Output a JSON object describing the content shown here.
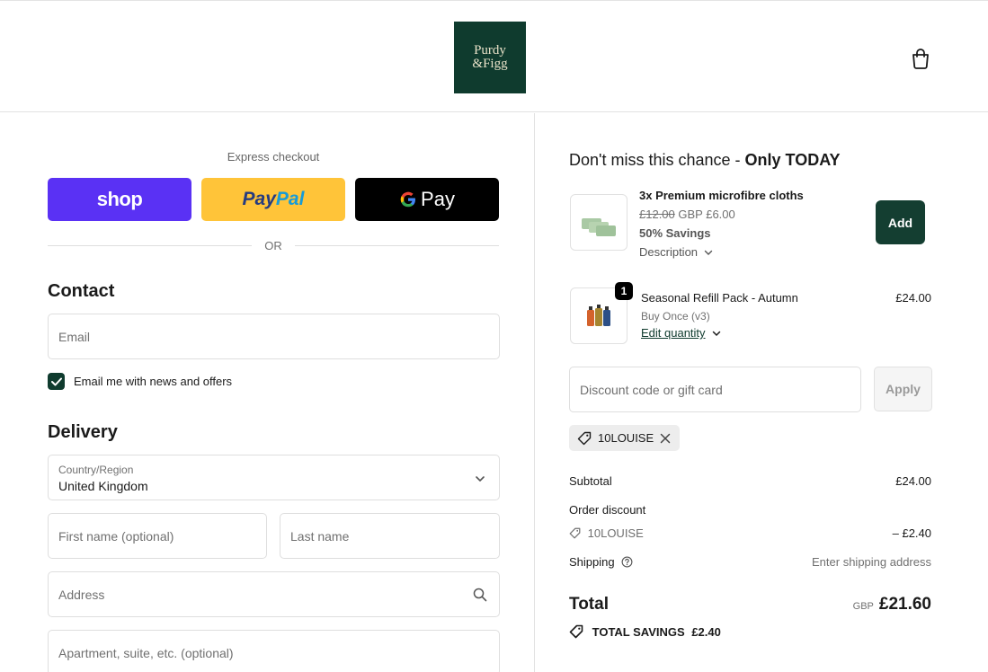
{
  "brand": {
    "logo_line1": "Purdy",
    "logo_line2": "&Figg"
  },
  "express": {
    "title": "Express checkout",
    "shop_label": "shop",
    "paypal_part1": "Pay",
    "paypal_part2": "Pal",
    "gpay_label": "Pay",
    "or_label": "OR"
  },
  "contact": {
    "title": "Contact",
    "email_placeholder": "Email",
    "newsletter_label": "Email me with news and offers"
  },
  "delivery": {
    "title": "Delivery",
    "country_label": "Country/Region",
    "country_value": "United Kingdom",
    "first_name_placeholder": "First name (optional)",
    "last_name_placeholder": "Last name",
    "address_placeholder": "Address",
    "apartment_placeholder": "Apartment, suite, etc. (optional)"
  },
  "upsell": {
    "title_prefix": "Don't miss this chance - ",
    "title_bold": "Only TODAY",
    "product_name": "3x Premium microfibre cloths",
    "old_price": "£12.00",
    "new_price": "GBP £6.00",
    "savings": "50% Savings",
    "description_label": "Description",
    "add_label": "Add"
  },
  "cart": {
    "item_name": "Seasonal Refill Pack - Autumn",
    "item_variant": "Buy Once (v3)",
    "edit_quantity_label": "Edit quantity",
    "item_price": "£24.00",
    "quantity": "1"
  },
  "discount": {
    "placeholder": "Discount code or gift card",
    "apply_label": "Apply",
    "applied_code": "10LOUISE"
  },
  "summary": {
    "subtotal_label": "Subtotal",
    "subtotal_value": "£24.00",
    "order_discount_label": "Order discount",
    "discount_code": "10LOUISE",
    "discount_value": "– £2.40",
    "shipping_label": "Shipping",
    "shipping_value": "Enter shipping address",
    "total_label": "Total",
    "currency": "GBP",
    "total_value": "£21.60",
    "savings_label": "TOTAL SAVINGS",
    "savings_value": "£2.40"
  },
  "colors": {
    "brand_green": "#0f3b2e",
    "shop_purple": "#5a31f4",
    "paypal_yellow": "#ffc439",
    "gpay_black": "#000000"
  }
}
